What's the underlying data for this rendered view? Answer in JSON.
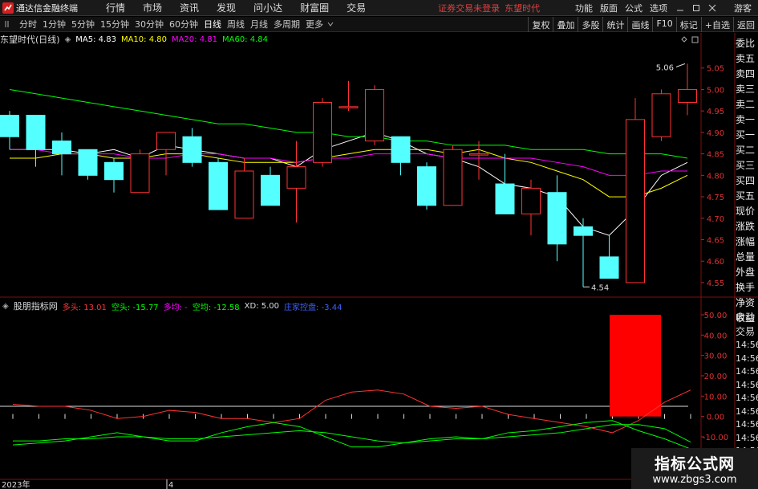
{
  "app": {
    "title": "通达信金融终端",
    "menu": [
      "行情",
      "市场",
      "资讯",
      "发现",
      "问小达",
      "财富圈",
      "交易"
    ],
    "notice": "证券交易未登录",
    "stock_top": "东望时代",
    "right_menu": [
      "功能",
      "版面",
      "公式",
      "选项"
    ],
    "guest": "游客",
    "colors": {
      "up": "#ff3333",
      "down": "#54ffff",
      "ma5": "#ffffff",
      "ma10": "#ffff00",
      "ma20": "#ff00ff",
      "ma60": "#00ff00"
    }
  },
  "toolbar": {
    "periods": [
      "分时",
      "1分钟",
      "5分钟",
      "15分钟",
      "30分钟",
      "60分钟",
      "日线",
      "周线",
      "月线",
      "多周期",
      "更多"
    ],
    "active_period": "日线",
    "tools": [
      "复权",
      "叠加",
      "多股",
      "统计",
      "画线",
      "F10",
      "标记",
      "+自选",
      "返回"
    ]
  },
  "main_chart": {
    "title": "东望时代(日线)",
    "ma": [
      {
        "label": "MA5: 4.83",
        "color": "#ffffff"
      },
      {
        "label": "MA10: 4.80",
        "color": "#ffff00"
      },
      {
        "label": "MA20: 4.81",
        "color": "#ff00ff"
      },
      {
        "label": "MA60: 4.84",
        "color": "#00ff00"
      }
    ],
    "high_label": "5.06",
    "low_label": "4.54"
  },
  "side_panel": [
    "委比",
    "卖五",
    "卖四",
    "卖三",
    "卖二",
    "卖一",
    "买一",
    "买二",
    "买三",
    "买四",
    "买五",
    "现价",
    "涨跌",
    "涨幅",
    "总量",
    "外盘",
    "换手",
    "净资",
    "收益"
  ],
  "side_panel2": [
    "自动",
    "交易"
  ],
  "side_times": [
    "14:56",
    "14:56",
    "14:56",
    "14:56",
    "14:56",
    "14:56",
    "14:56",
    "14:56",
    "14:56"
  ],
  "indicator": {
    "name": "股朋指标网",
    "items": [
      {
        "label": "多头: 13.01",
        "color": "#ff3333"
      },
      {
        "label": "空头: -15.77",
        "color": "#00ff00"
      },
      {
        "label": "多均: -",
        "color": "#ff00ff"
      },
      {
        "label": "空均: -12.58",
        "color": "#00ff00"
      },
      {
        "label": "XD: 5.00",
        "color": "#dddddd"
      },
      {
        "label": "庄家控盘: -3.44",
        "color": "#4060ff"
      }
    ]
  },
  "x_axis": [
    "2023年",
    "4"
  ],
  "watermark": {
    "title": "指标公式网",
    "url": "www.zbgs3.com"
  },
  "chart_data": [
    {
      "type": "candlestick",
      "title": "东望时代(日线)",
      "ylim": [
        4.52,
        5.1
      ],
      "y_ticks": [
        4.55,
        4.6,
        4.65,
        4.7,
        4.75,
        4.8,
        4.85,
        4.9,
        4.95,
        5.0,
        5.05
      ],
      "candles": [
        {
          "o": 4.94,
          "h": 4.95,
          "l": 4.86,
          "c": 4.89
        },
        {
          "o": 4.94,
          "h": 4.94,
          "l": 4.82,
          "c": 4.86
        },
        {
          "o": 4.88,
          "h": 4.9,
          "l": 4.8,
          "c": 4.85
        },
        {
          "o": 4.86,
          "h": 4.86,
          "l": 4.79,
          "c": 4.8
        },
        {
          "o": 4.83,
          "h": 4.84,
          "l": 4.76,
          "c": 4.79
        },
        {
          "o": 4.76,
          "h": 4.86,
          "l": 4.76,
          "c": 4.85
        },
        {
          "o": 4.86,
          "h": 4.9,
          "l": 4.8,
          "c": 4.9
        },
        {
          "o": 4.89,
          "h": 4.91,
          "l": 4.82,
          "c": 4.83
        },
        {
          "o": 4.83,
          "h": 4.84,
          "l": 4.72,
          "c": 4.72
        },
        {
          "o": 4.7,
          "h": 4.84,
          "l": 4.7,
          "c": 4.81
        },
        {
          "o": 4.8,
          "h": 4.82,
          "l": 4.73,
          "c": 4.73
        },
        {
          "o": 4.77,
          "h": 4.88,
          "l": 4.69,
          "c": 4.82
        },
        {
          "o": 4.83,
          "h": 4.98,
          "l": 4.82,
          "c": 4.97
        },
        {
          "o": 4.96,
          "h": 5.02,
          "l": 4.95,
          "c": 4.96
        },
        {
          "o": 4.88,
          "h": 5.01,
          "l": 4.87,
          "c": 5.0
        },
        {
          "o": 4.89,
          "h": 4.89,
          "l": 4.8,
          "c": 4.83
        },
        {
          "o": 4.82,
          "h": 4.83,
          "l": 4.72,
          "c": 4.73
        },
        {
          "o": 4.73,
          "h": 4.87,
          "l": 4.73,
          "c": 4.86
        },
        {
          "o": 4.85,
          "h": 4.88,
          "l": 4.79,
          "c": 4.85
        },
        {
          "o": 4.78,
          "h": 4.85,
          "l": 4.71,
          "c": 4.71
        },
        {
          "o": 4.71,
          "h": 4.79,
          "l": 4.66,
          "c": 4.77
        },
        {
          "o": 4.76,
          "h": 4.8,
          "l": 4.6,
          "c": 4.64
        },
        {
          "o": 4.68,
          "h": 4.7,
          "l": 4.54,
          "c": 4.66
        },
        {
          "o": 4.61,
          "h": 4.66,
          "l": 4.56,
          "c": 4.56
        },
        {
          "o": 4.55,
          "h": 4.98,
          "l": 4.55,
          "c": 4.93
        },
        {
          "o": 4.89,
          "h": 5.0,
          "l": 4.88,
          "c": 4.99
        },
        {
          "o": 4.97,
          "h": 5.06,
          "l": 4.94,
          "c": 5.0
        }
      ],
      "ma_series": [
        {
          "name": "MA5",
          "color": "#ffffff",
          "values": [
            4.86,
            4.86,
            4.86,
            4.85,
            4.86,
            4.84,
            4.87,
            4.86,
            4.85,
            4.84,
            4.84,
            4.82,
            4.86,
            4.88,
            4.9,
            4.88,
            4.85,
            4.84,
            4.82,
            4.78,
            4.77,
            4.75,
            4.68,
            4.66,
            4.72,
            4.8,
            4.83
          ]
        },
        {
          "name": "MA10",
          "color": "#ffff00",
          "values": [
            4.84,
            4.84,
            4.85,
            4.85,
            4.84,
            4.84,
            4.85,
            4.85,
            4.84,
            4.83,
            4.83,
            4.83,
            4.84,
            4.85,
            4.86,
            4.86,
            4.86,
            4.85,
            4.86,
            4.84,
            4.83,
            4.81,
            4.79,
            4.75,
            4.75,
            4.77,
            4.8
          ]
        },
        {
          "name": "MA20",
          "color": "#ff00ff",
          "values": [
            4.86,
            4.86,
            4.85,
            4.85,
            4.85,
            4.84,
            4.84,
            4.85,
            4.85,
            4.84,
            4.84,
            4.83,
            4.84,
            4.84,
            4.85,
            4.85,
            4.85,
            4.84,
            4.84,
            4.84,
            4.84,
            4.83,
            4.82,
            4.8,
            4.8,
            4.81,
            4.81
          ]
        },
        {
          "name": "MA60",
          "color": "#00ff00",
          "values": [
            5.0,
            4.99,
            4.98,
            4.97,
            4.96,
            4.95,
            4.94,
            4.93,
            4.92,
            4.92,
            4.91,
            4.9,
            4.9,
            4.89,
            4.89,
            4.88,
            4.88,
            4.87,
            4.87,
            4.87,
            4.86,
            4.86,
            4.86,
            4.85,
            4.85,
            4.85,
            4.84
          ]
        }
      ]
    },
    {
      "type": "line",
      "title": "股朋指标网",
      "ylim": [
        -15,
        55
      ],
      "y_ticks": [
        50,
        40,
        30,
        20,
        10,
        0,
        -10
      ],
      "series": [
        {
          "name": "多头",
          "color": "#ff3333",
          "values": [
            6,
            5,
            5,
            3,
            -1,
            0,
            3,
            2,
            -1,
            -1,
            -3,
            -1,
            8,
            12,
            13,
            11,
            5,
            4,
            5,
            1,
            -1,
            -3,
            -5,
            -8,
            -2,
            7,
            13
          ]
        },
        {
          "name": "空头",
          "color": "#00ff00",
          "values": [
            -14,
            -13,
            -12,
            -10,
            -8,
            -10,
            -12,
            -12,
            -8,
            -5,
            -3,
            -5,
            -10,
            -15,
            -15,
            -13,
            -11,
            -10,
            -11,
            -8,
            -7,
            -5,
            -3,
            -2,
            -7,
            -11,
            -16
          ]
        },
        {
          "name": "空均",
          "color": "#00ff00",
          "values": [
            -12,
            -12,
            -11,
            -11,
            -10,
            -10,
            -11,
            -11,
            -10,
            -9,
            -8,
            -7,
            -8,
            -10,
            -12,
            -13,
            -12,
            -11,
            -11,
            -10,
            -9,
            -8,
            -6,
            -4,
            -4,
            -6,
            -12.58
          ]
        }
      ],
      "bars": [
        {
          "index": 24,
          "top": 50,
          "bottom": 0,
          "color": "#ff0000"
        }
      ],
      "xd": 5.0
    }
  ]
}
